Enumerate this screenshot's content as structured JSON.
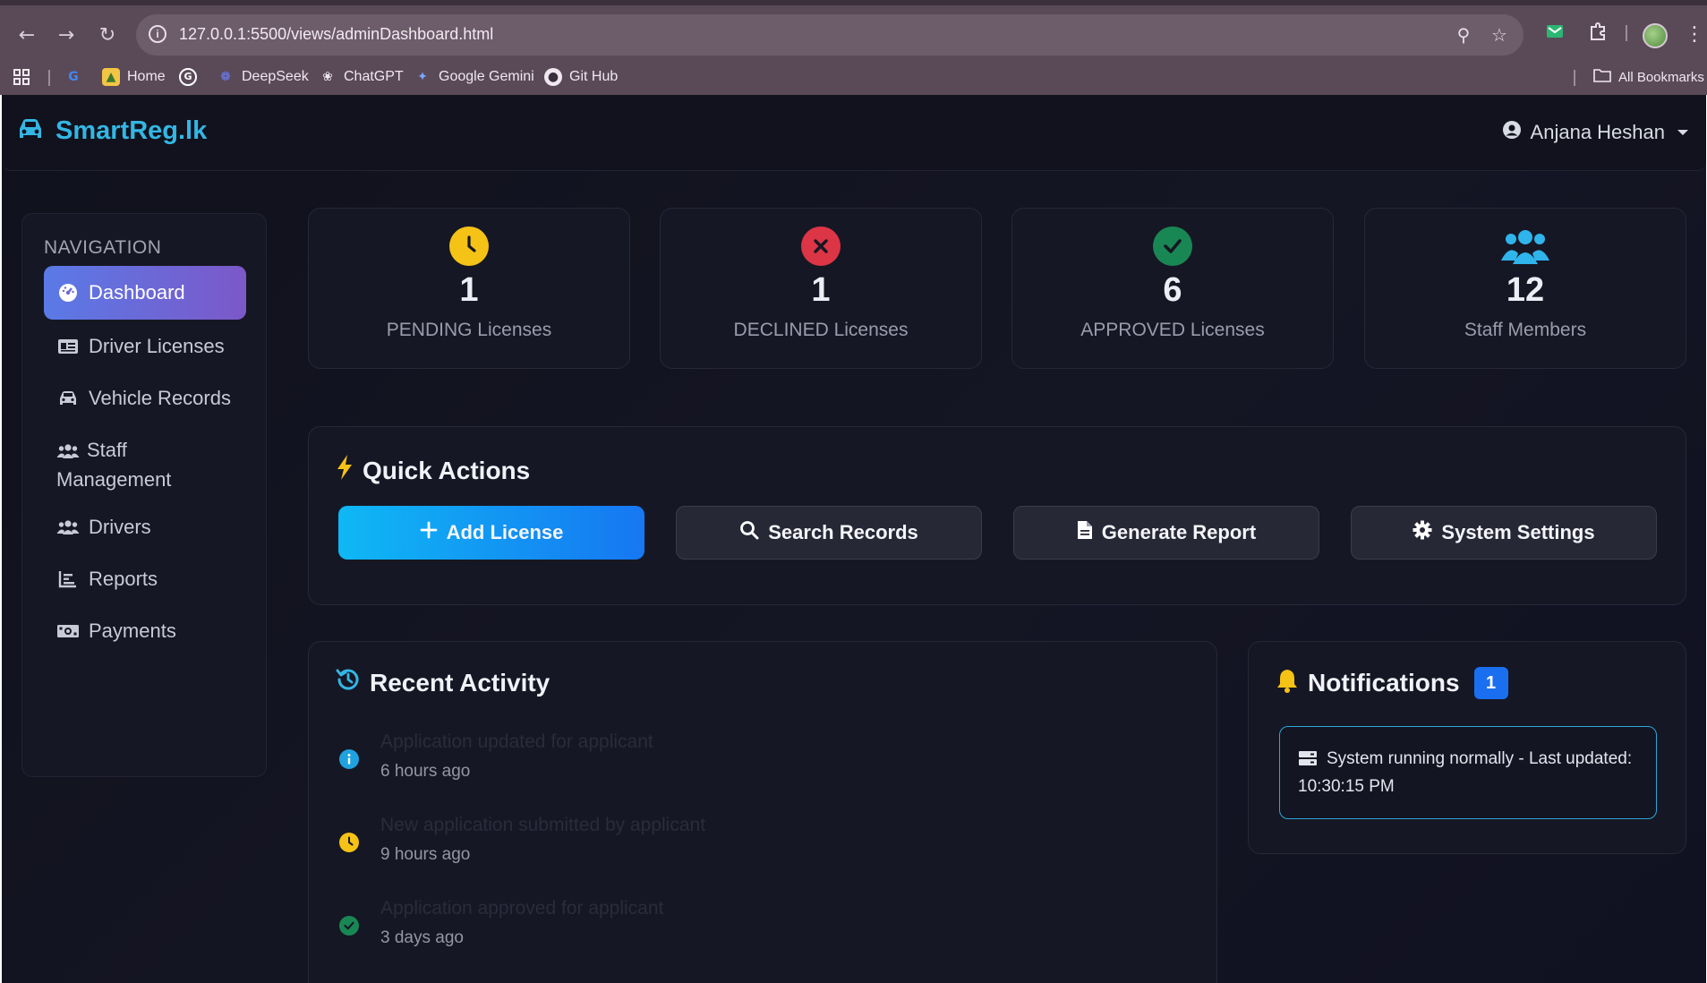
{
  "browser": {
    "url": "127.0.0.1:5500/views/adminDashboard.html",
    "bookmarks": [
      {
        "label": "Home"
      },
      {
        "label": "DeepSeek"
      },
      {
        "label": "ChatGPT"
      },
      {
        "label": "Google Gemini"
      },
      {
        "label": "Git Hub"
      }
    ],
    "all_bookmarks": "All Bookmarks"
  },
  "app": {
    "brand": "SmartReg.lk",
    "user_name": "Anjana Heshan",
    "accent_color": "#34b6e4"
  },
  "sidebar": {
    "title": "NAVIGATION",
    "items": [
      {
        "label": "Dashboard",
        "icon": "gauge-icon",
        "active": true
      },
      {
        "label": "Driver Licenses",
        "icon": "id-card-icon"
      },
      {
        "label": "Vehicle Records",
        "icon": "car-icon"
      },
      {
        "label": "Staff Management",
        "icon": "users-icon"
      },
      {
        "label": "Drivers",
        "icon": "users-icon"
      },
      {
        "label": "Reports",
        "icon": "chart-icon"
      },
      {
        "label": "Payments",
        "icon": "money-icon"
      }
    ]
  },
  "stats": [
    {
      "value": "1",
      "label": "PENDING Licenses",
      "icon": "clock-icon",
      "color": "#f5c216"
    },
    {
      "value": "1",
      "label": "DECLINED Licenses",
      "icon": "x-circle-icon",
      "color": "#dc3545"
    },
    {
      "value": "6",
      "label": "APPROVED Licenses",
      "icon": "check-circle-icon",
      "color": "#198754"
    },
    {
      "value": "12",
      "label": "Staff Members",
      "icon": "users-icon",
      "color": "#30b4ec"
    }
  ],
  "quick_actions": {
    "title": "Quick Actions",
    "buttons": [
      {
        "label": "Add License",
        "icon": "plus-icon"
      },
      {
        "label": "Search Records",
        "icon": "search-icon"
      },
      {
        "label": "Generate Report",
        "icon": "file-icon"
      },
      {
        "label": "System Settings",
        "icon": "gear-icon"
      }
    ]
  },
  "recent_activity": {
    "title": "Recent Activity",
    "items": [
      {
        "text": "Application updated for applicant",
        "time": "6 hours ago",
        "icon": "info-icon",
        "color": "#1fa2df"
      },
      {
        "text": "New application submitted by applicant",
        "time": "9 hours ago",
        "icon": "clock-icon",
        "color": "#f5c216"
      },
      {
        "text": "Application approved for applicant",
        "time": "3 days ago",
        "icon": "check-circle-icon",
        "color": "#198754"
      }
    ]
  },
  "notifications": {
    "title": "Notifications",
    "count": "1",
    "message": "System running normally - Last updated: 10:30:15 PM"
  }
}
